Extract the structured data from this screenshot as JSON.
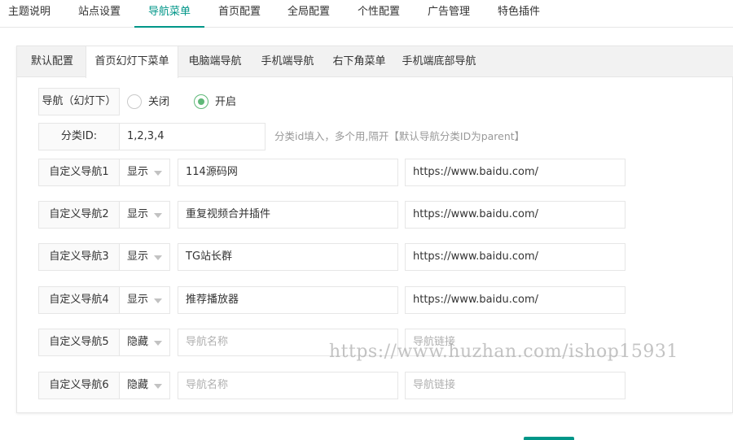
{
  "top_tabs": [
    {
      "label": "主题说明"
    },
    {
      "label": "站点设置"
    },
    {
      "label": "导航菜单",
      "active": true
    },
    {
      "label": "首页配置"
    },
    {
      "label": "全局配置"
    },
    {
      "label": "个性配置"
    },
    {
      "label": "广告管理"
    },
    {
      "label": "特色插件"
    }
  ],
  "sub_tabs": [
    {
      "label": "默认配置"
    },
    {
      "label": "首页幻灯下菜单",
      "active": true
    },
    {
      "label": "电脑端导航"
    },
    {
      "label": "手机端导航"
    },
    {
      "label": "右下角菜单"
    },
    {
      "label": "手机端底部导航"
    }
  ],
  "nav_switch": {
    "label": "导航（幻灯下）",
    "option_off": "关闭",
    "option_on": "开启",
    "selected": "开启"
  },
  "category": {
    "label": "分类ID:",
    "value": "1,2,3,4",
    "hint": "分类id填入，多个用,隔开【默认导航分类ID为parent】"
  },
  "custom_navs": [
    {
      "label": "自定义导航1",
      "visibility": "显示",
      "name": "114源码网",
      "name_placeholder": "导航名称",
      "link": "https://www.baidu.com/",
      "link_placeholder": "导航链接"
    },
    {
      "label": "自定义导航2",
      "visibility": "显示",
      "name": "重复视频合并插件",
      "name_placeholder": "导航名称",
      "link": "https://www.baidu.com/",
      "link_placeholder": "导航链接"
    },
    {
      "label": "自定义导航3",
      "visibility": "显示",
      "name": "TG站长群",
      "name_placeholder": "导航名称",
      "link": "https://www.baidu.com/",
      "link_placeholder": "导航链接"
    },
    {
      "label": "自定义导航4",
      "visibility": "显示",
      "name": "推荐播放器",
      "name_placeholder": "导航名称",
      "link": "https://www.baidu.com/",
      "link_placeholder": "导航链接"
    },
    {
      "label": "自定义导航5",
      "visibility": "隐藏",
      "name": "",
      "name_placeholder": "导航名称",
      "link": "",
      "link_placeholder": "导航链接"
    },
    {
      "label": "自定义导航6",
      "visibility": "隐藏",
      "name": "",
      "name_placeholder": "导航名称",
      "link": "",
      "link_placeholder": "导航链接"
    }
  ],
  "watermark": "https://www.huzhan.com/ishop15931",
  "colors": {
    "accent": "#009688",
    "radio": "#5fb878"
  },
  "icons": {
    "caret": "caret-down-icon"
  }
}
